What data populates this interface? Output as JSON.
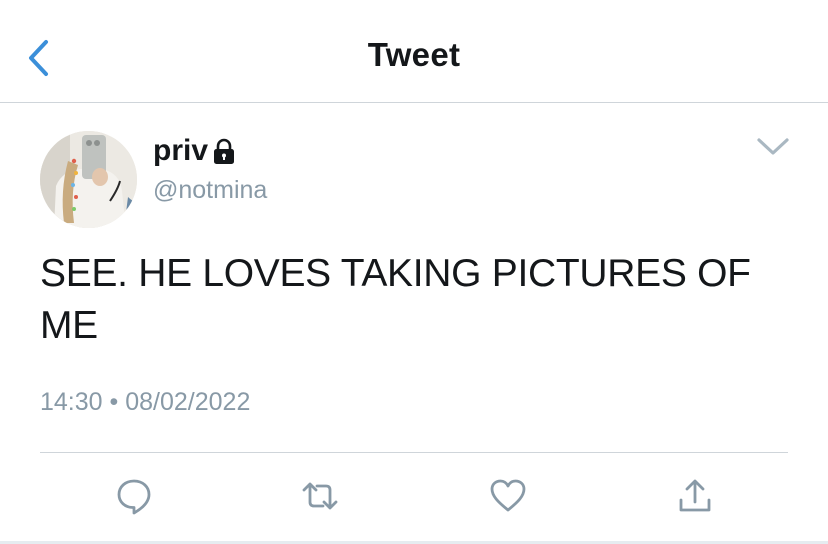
{
  "header": {
    "title": "Tweet",
    "back_icon": "chevron-left-icon",
    "accent_color": "#3b8fd9"
  },
  "tweet": {
    "display_name": "priv",
    "protected_icon": "lock-icon",
    "handle": "@notmina",
    "text": "SEE. HE LOVES TAKING PICTURES OF ME",
    "time": "14:30",
    "separator": "•",
    "date": "08/02/2022",
    "more_icon": "chevron-down-icon"
  },
  "actions": {
    "reply_icon": "reply-icon",
    "retweet_icon": "retweet-icon",
    "like_icon": "heart-icon",
    "share_icon": "share-icon",
    "icon_color": "#8899a6"
  }
}
